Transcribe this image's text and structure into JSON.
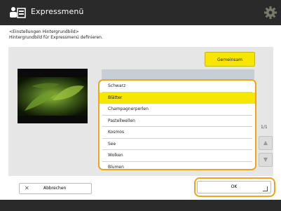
{
  "header": {
    "title": "Expressmenü",
    "logo_icon": "app-person-icon",
    "settings_icon": "gear-icon"
  },
  "breadcrumb": {
    "line1": "<Einstellungen Hintergrundbild>",
    "line2": "Hintergrundbild für Expressmenü definieren."
  },
  "actions": {
    "common_label": "Gemeinsam"
  },
  "wallpaper_list": {
    "items": [
      "Schwarz",
      "Blätter",
      "Champagnerperlen",
      "Pastellwellen",
      "Kosmos",
      "See",
      "Wolken",
      "Blumen"
    ],
    "selected": "Blätter"
  },
  "pagination": {
    "page": "1/1"
  },
  "footer": {
    "cancel_label": "Abbrechen",
    "ok_label": "OK"
  },
  "colors": {
    "accent_yellow": "#f7e600",
    "focus_orange": "#f0a419",
    "bar_dark": "#2a2a2a"
  }
}
